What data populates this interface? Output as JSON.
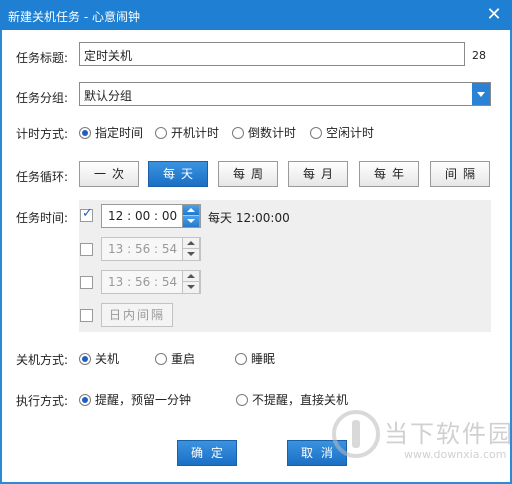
{
  "window": {
    "title": "新建关机任务 - 心意闹钟",
    "close_glyph": "✕"
  },
  "title_field": {
    "label": "任务标题:",
    "value": "定时关机",
    "char_count": "28"
  },
  "group_field": {
    "label": "任务分组:",
    "value": "默认分组"
  },
  "timer_mode": {
    "label": "计时方式:",
    "options": [
      "指定时间",
      "开机计时",
      "倒数计时",
      "空闲计时"
    ],
    "selected": "指定时间"
  },
  "repeat": {
    "label": "任务循环:",
    "options": [
      "一次",
      "每天",
      "每周",
      "每月",
      "每年",
      "间隔"
    ],
    "selected": "每天"
  },
  "task_time": {
    "label": "任务时间:",
    "rows": [
      {
        "checked": true,
        "value": "12 : 00 : 00",
        "summary": "每天 12:00:00",
        "enabled": true
      },
      {
        "checked": false,
        "value": "13 : 56 : 54",
        "enabled": false
      },
      {
        "checked": false,
        "value": "13 : 56 : 54",
        "enabled": false
      }
    ],
    "interval_button": "日内间隔"
  },
  "shutdown_mode": {
    "label": "关机方式:",
    "options": [
      "关机",
      "重启",
      "睡眠"
    ],
    "selected": "关机"
  },
  "exec_mode": {
    "label": "执行方式:",
    "options": [
      "提醒，预留一分钟",
      "不提醒，直接关机"
    ],
    "selected": "提醒，预留一分钟"
  },
  "footer": {
    "ok_label": "确定",
    "cancel_label": "取消"
  },
  "watermark": {
    "text": "当下软件园",
    "url": "www.downxia.com"
  },
  "colors": {
    "accent": "#1e7fd3",
    "button": "#2a82d6"
  }
}
